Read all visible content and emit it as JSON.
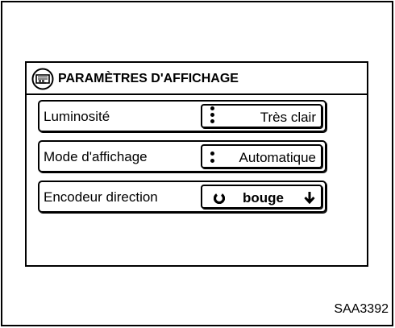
{
  "header": {
    "title": "PARAMÈTRES D'AFFICHAGE",
    "icon": "display-settings-icon"
  },
  "rows": [
    {
      "label": "Luminosité",
      "value": "Très clair",
      "indicator": "slider-dots-icon"
    },
    {
      "label": "Mode d'affichage",
      "value": "Automatique",
      "indicator": "slider-dots-icon"
    },
    {
      "label": "Encodeur direction",
      "value": "bouge",
      "left_icon": "rotary-knob-icon",
      "right_icon": "arrow-down-icon"
    }
  ],
  "figure_code": "SAA3392"
}
